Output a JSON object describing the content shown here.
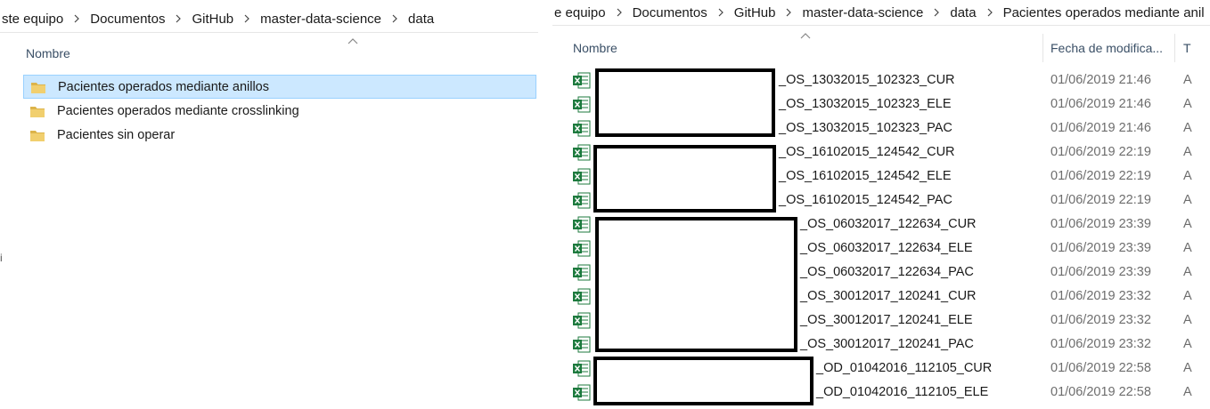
{
  "left_window": {
    "breadcrumb": [
      "ste equipo",
      "Documentos",
      "GitHub",
      "master-data-science",
      "data"
    ],
    "column_name": "Nombre",
    "folders": [
      {
        "name": "Pacientes operados mediante anillos",
        "selected": true
      },
      {
        "name": "Pacientes operados mediante crosslinking",
        "selected": false
      },
      {
        "name": "Pacientes sin operar",
        "selected": false
      }
    ],
    "edge_text": "i"
  },
  "right_window": {
    "breadcrumb": [
      "e equipo",
      "Documentos",
      "GitHub",
      "master-data-science",
      "data",
      "Pacientes operados mediante anil"
    ],
    "columns": {
      "name": "Nombre",
      "date": "Fecha de modifica...",
      "type": "T"
    },
    "files": [
      {
        "name": "_OS_13032015_102323_CUR",
        "date": "01/06/2019 21:46",
        "type": "A"
      },
      {
        "name": "_OS_13032015_102323_ELE",
        "date": "01/06/2019 21:46",
        "type": "A"
      },
      {
        "name": "_OS_13032015_102323_PAC",
        "date": "01/06/2019 21:46",
        "type": "A"
      },
      {
        "name": "_OS_16102015_124542_CUR",
        "date": "01/06/2019 22:19",
        "type": "A"
      },
      {
        "name": "_OS_16102015_124542_ELE",
        "date": "01/06/2019 22:19",
        "type": "A"
      },
      {
        "name": "_OS_16102015_124542_PAC",
        "date": "01/06/2019 22:19",
        "type": "A"
      },
      {
        "name": "_OS_06032017_122634_CUR",
        "date": "01/06/2019 23:39",
        "type": "A"
      },
      {
        "name": "_OS_06032017_122634_ELE",
        "date": "01/06/2019 23:39",
        "type": "A"
      },
      {
        "name": "_OS_06032017_122634_PAC",
        "date": "01/06/2019 23:39",
        "type": "A"
      },
      {
        "name": "_OS_30012017_120241_CUR",
        "date": "01/06/2019 23:32",
        "type": "A"
      },
      {
        "name": "_OS_30012017_120241_ELE",
        "date": "01/06/2019 23:32",
        "type": "A"
      },
      {
        "name": "_OS_30012017_120241_PAC",
        "date": "01/06/2019 23:32",
        "type": "A"
      },
      {
        "name": "_OD_01042016_112105_CUR",
        "date": "01/06/2019 22:58",
        "type": "A"
      },
      {
        "name": "_OD_01042016_112105_ELE",
        "date": "01/06/2019 22:58",
        "type": "A"
      }
    ]
  },
  "colors": {
    "selection_bg": "#cce8ff",
    "selection_border": "#99d1ff",
    "folder": "#dcb44a",
    "excel": "#1d7a3e"
  },
  "icons": {
    "folder": "folder-icon",
    "excel_file": "excel-file-icon",
    "separator": "chevron-right-icon",
    "sort": "sort-up-icon"
  }
}
